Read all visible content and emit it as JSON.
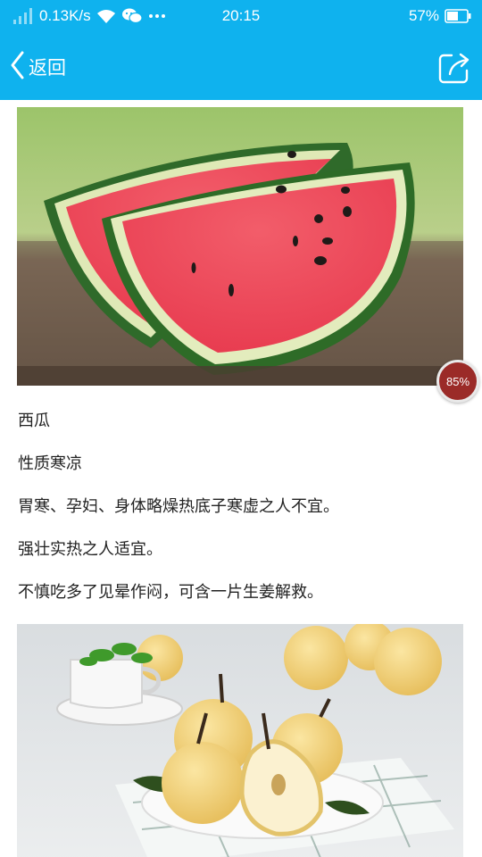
{
  "status_bar": {
    "speed": "0.13K/s",
    "time": "20:15",
    "battery": "57%",
    "battery_level": 0.57,
    "icons": [
      "signal-icon",
      "wifi-icon",
      "wechat-icon",
      "more-dots-icon",
      "battery-icon"
    ]
  },
  "title_bar": {
    "back_label": "返回",
    "icons": [
      "back-chevron-icon",
      "share-icon"
    ]
  },
  "article": {
    "lines": [
      "西瓜",
      "性质寒凉",
      "胃寒、孕妇、身体略燥热底子寒虚之人不宜。",
      "强壮实热之人适宜。",
      "不慎吃多了见晕作闷，可含一片生姜解救。"
    ]
  },
  "floating_badge": {
    "label": "85%"
  },
  "colors": {
    "brand": "#0fb2ee",
    "text": "#222222",
    "badge": "#9b2b28"
  }
}
